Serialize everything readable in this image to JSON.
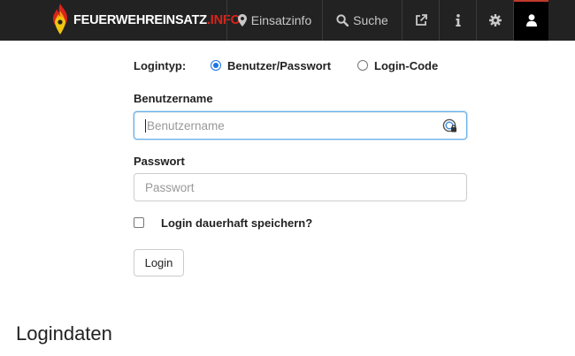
{
  "brand": {
    "main": "FEUERWEHREINSATZ",
    "sub": ".INFO"
  },
  "nav": {
    "einsatzinfo": "Einsatzinfo",
    "suche": "Suche",
    "icons": [
      "map-marker-icon",
      "search-icon",
      "external-link-icon",
      "info-icon",
      "gear-icon",
      "user-icon"
    ]
  },
  "form": {
    "logintyp_label": "Logintyp:",
    "options": [
      {
        "label": "Benutzer/Passwort",
        "selected": true
      },
      {
        "label": "Login-Code",
        "selected": false
      }
    ],
    "username": {
      "label": "Benutzername",
      "placeholder": "Benutzername",
      "value": ""
    },
    "password": {
      "label": "Passwort",
      "placeholder": "Passwort",
      "value": ""
    },
    "remember": {
      "label": "Login dauerhaft speichern?",
      "checked": false
    },
    "submit_label": "Login"
  },
  "section": {
    "heading": "Logindaten"
  },
  "colors": {
    "navbar": "#222222",
    "accent_red": "#d9241b",
    "radio_blue": "#1a73e8",
    "focus_border": "#66afe9"
  }
}
